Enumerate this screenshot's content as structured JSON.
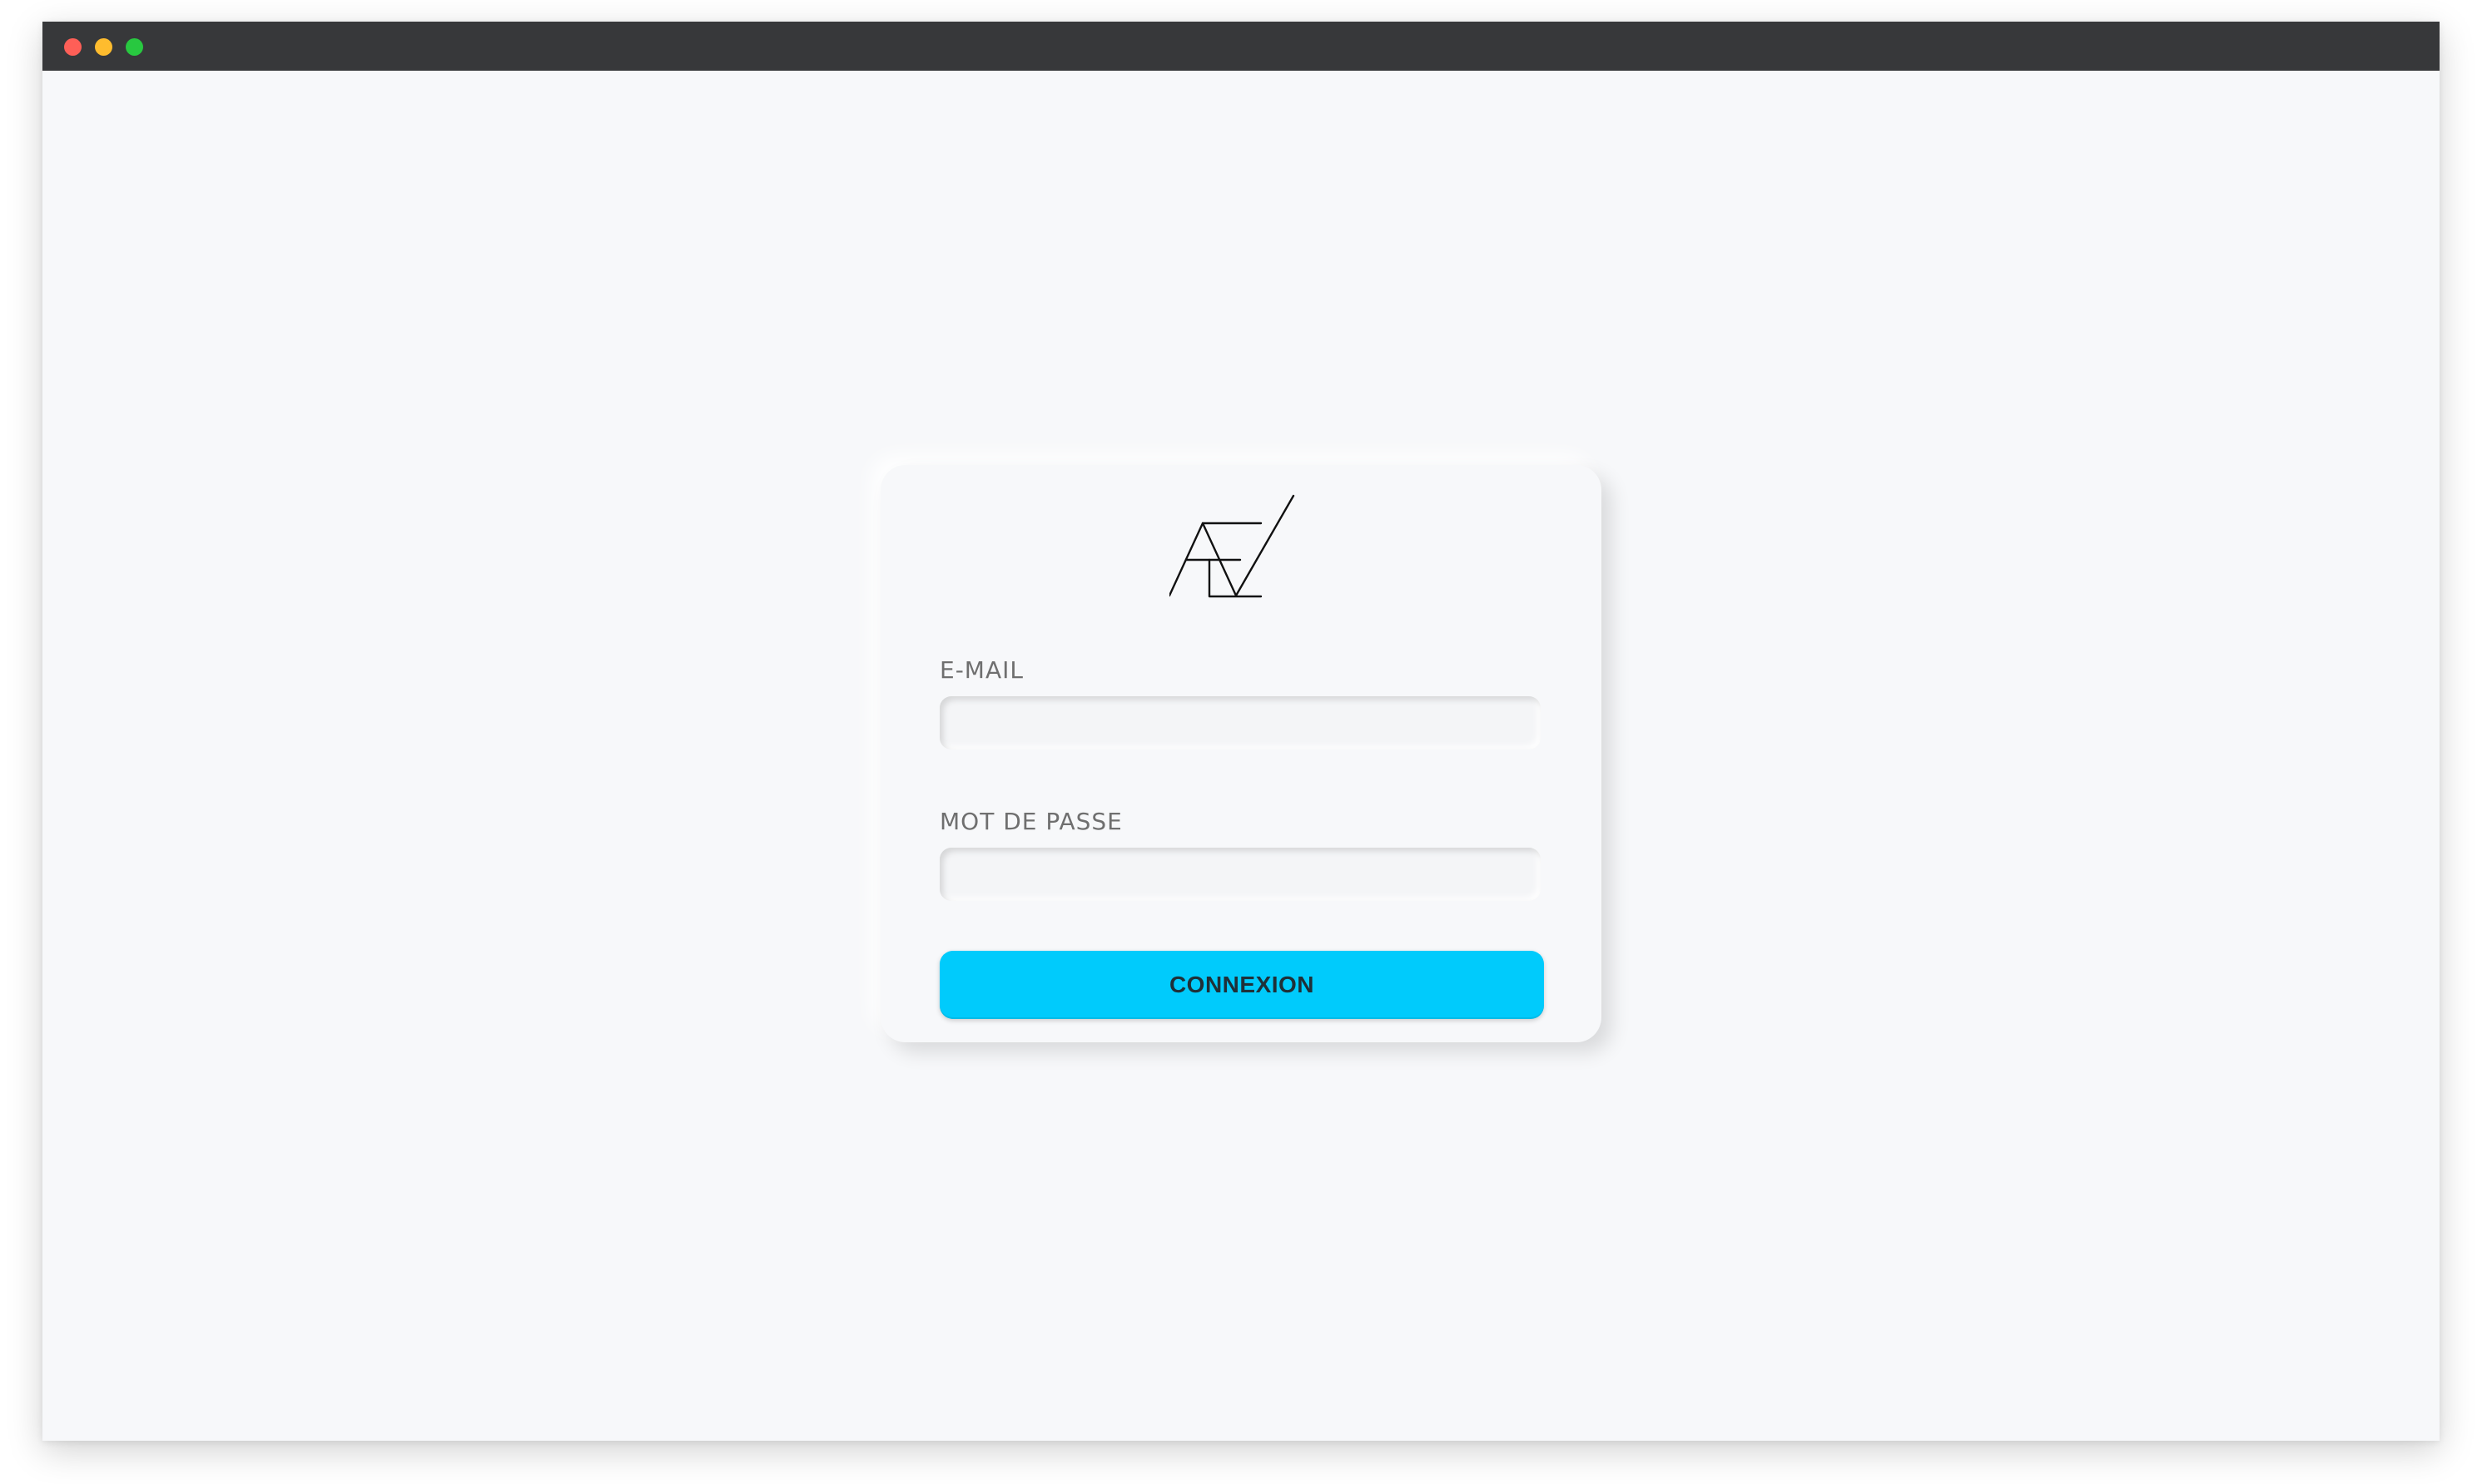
{
  "window": {
    "controls": {
      "close_color": "#fe5f57",
      "minimize_color": "#febc2e",
      "maximize_color": "#28c840"
    }
  },
  "login": {
    "logo_icon": "av-monogram-logo",
    "email_label": "E-MAIL",
    "email_value": "",
    "email_placeholder": "",
    "password_label": "MOT DE PASSE",
    "password_value": "",
    "password_placeholder": "",
    "submit_label": "CONNEXION",
    "accent_color": "#00cbfc"
  }
}
